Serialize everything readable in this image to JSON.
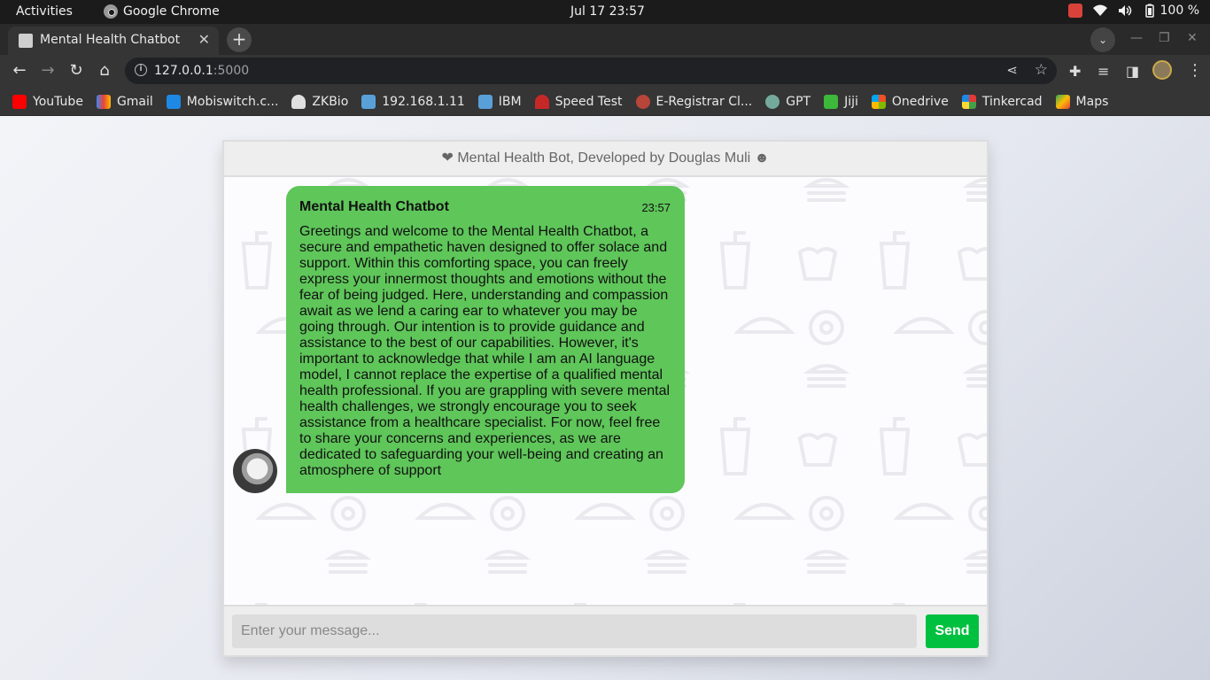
{
  "os": {
    "activities": "Activities",
    "app_name": "Google Chrome",
    "clock": "Jul 17  23:57",
    "battery": "100 %"
  },
  "browser": {
    "tab_title": "Mental Health Chatbot",
    "url_host": "127.0.0.1",
    "url_port": ":5000",
    "bookmarks": [
      "YouTube",
      "Gmail",
      "Mobiswitch.c...",
      "ZKBio",
      "192.168.1.11",
      "IBM",
      "Speed Test",
      "E-Registrar Cl...",
      "GPT",
      "Jiji",
      "Onedrive",
      "Tinkercad",
      "Maps"
    ]
  },
  "chat": {
    "header": "❤ Mental Health Bot, Developed by Douglas Muli ☻",
    "message": {
      "sender": "Mental Health Chatbot",
      "time": "23:57",
      "text": "Greetings and welcome to the Mental Health Chatbot, a secure and empathetic haven designed to offer solace and support. Within this comforting space, you can freely express your innermost thoughts and emotions without the fear of being judged. Here, understanding and compassion await as we lend a caring ear to whatever you may be going through. Our intention is to provide guidance and assistance to the best of our capabilities. However, it's important to acknowledge that while I am an AI language model, I cannot replace the expertise of a qualified mental health professional. If you are grappling with severe mental health challenges, we strongly encourage you to seek assistance from a healthcare specialist. For now, feel free to share your concerns and experiences, as we are dedicated to safeguarding your well-being and creating an atmosphere of support"
    },
    "input_placeholder": "Enter your message...",
    "send_label": "Send"
  },
  "colors": {
    "bubble": "#5fc65a",
    "send_button": "#00c03f"
  }
}
